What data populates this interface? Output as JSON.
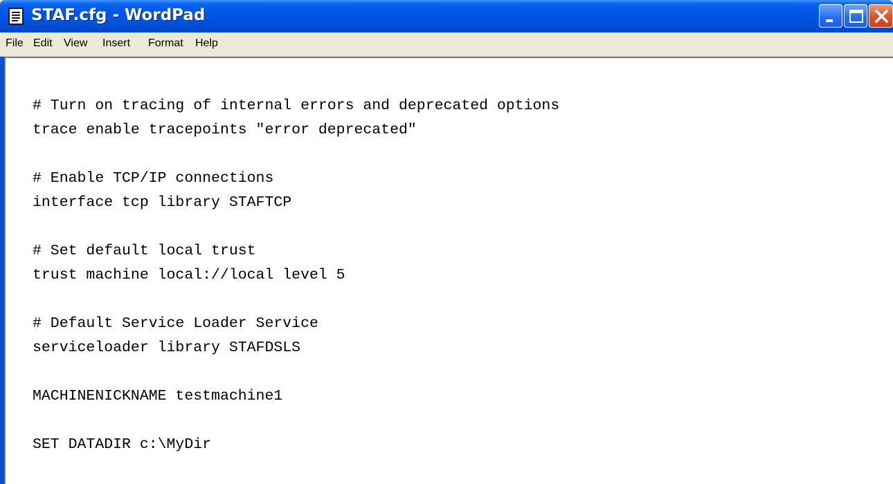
{
  "window": {
    "title": "STAF.cfg - WordPad",
    "icon": "wordpad-document-icon",
    "buttons": {
      "minimize": "minimize-icon",
      "maximize": "maximize-icon",
      "close": "close-icon"
    }
  },
  "menu": {
    "file": "File",
    "edit": "Edit",
    "view": "View",
    "insert": "Insert",
    "format": "Format",
    "help": "Help"
  },
  "document": {
    "lines": [
      "# Turn on tracing of internal errors and deprecated options",
      "trace enable tracepoints \"error deprecated\"",
      "",
      "# Enable TCP/IP connections",
      "interface tcp library STAFTCP",
      "",
      "# Set default local trust",
      "trust machine local://local level 5",
      "",
      "# Default Service Loader Service",
      "serviceloader library STAFDSLS",
      "",
      "MACHINENICKNAME testmachine1",
      "",
      "SET DATADIR c:\\MyDir"
    ]
  },
  "colors": {
    "titlebar": "#0055e5",
    "menubar": "#ece9d8",
    "close_button": "#e0542c"
  }
}
